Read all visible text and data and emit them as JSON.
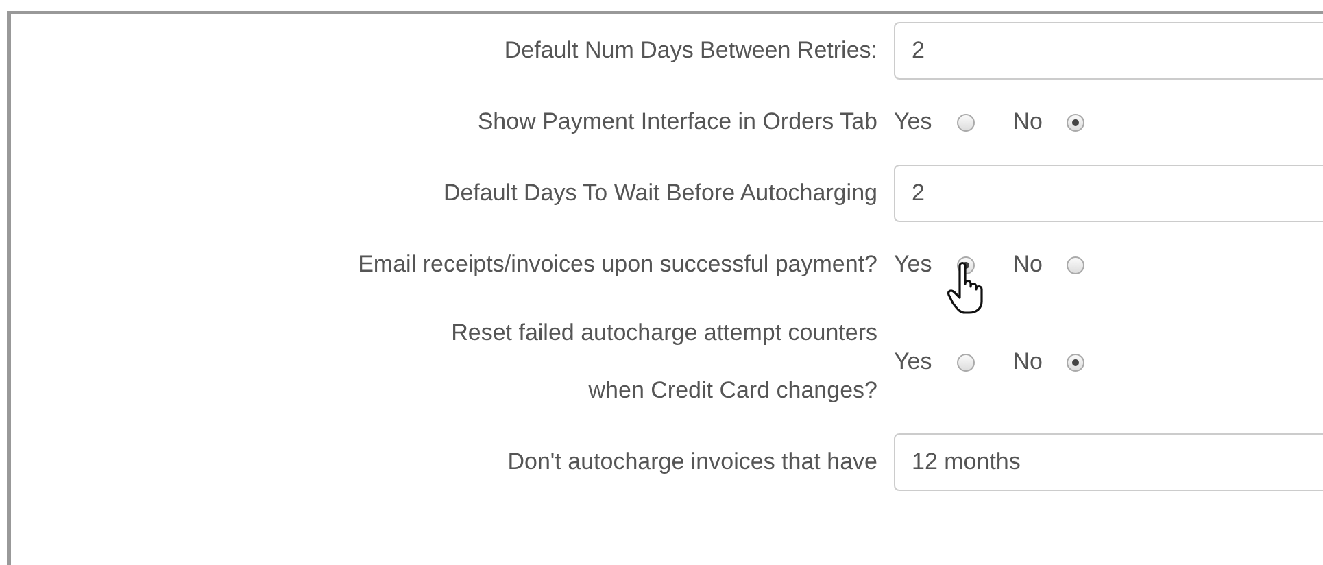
{
  "settings": [
    {
      "kind": "text",
      "label": "Default Num Days Between Retries:",
      "value": "2"
    },
    {
      "kind": "radio",
      "label": "Show Payment Interface in Orders Tab",
      "options": [
        {
          "label": "Yes",
          "selected": false
        },
        {
          "label": "No",
          "selected": true
        }
      ]
    },
    {
      "kind": "text",
      "label": "Default Days To Wait Before Autocharging",
      "value": "2"
    },
    {
      "kind": "radio",
      "label": "Email receipts/invoices upon successful payment?",
      "options": [
        {
          "label": "Yes",
          "selected": true
        },
        {
          "label": "No",
          "selected": false
        }
      ]
    },
    {
      "kind": "radio",
      "label": "Reset failed autocharge attempt counters when Credit Card changes?",
      "options": [
        {
          "label": "Yes",
          "selected": false
        },
        {
          "label": "No",
          "selected": true
        }
      ]
    },
    {
      "kind": "text",
      "label": "Don't autocharge invoices that have",
      "value": "12 months"
    }
  ]
}
